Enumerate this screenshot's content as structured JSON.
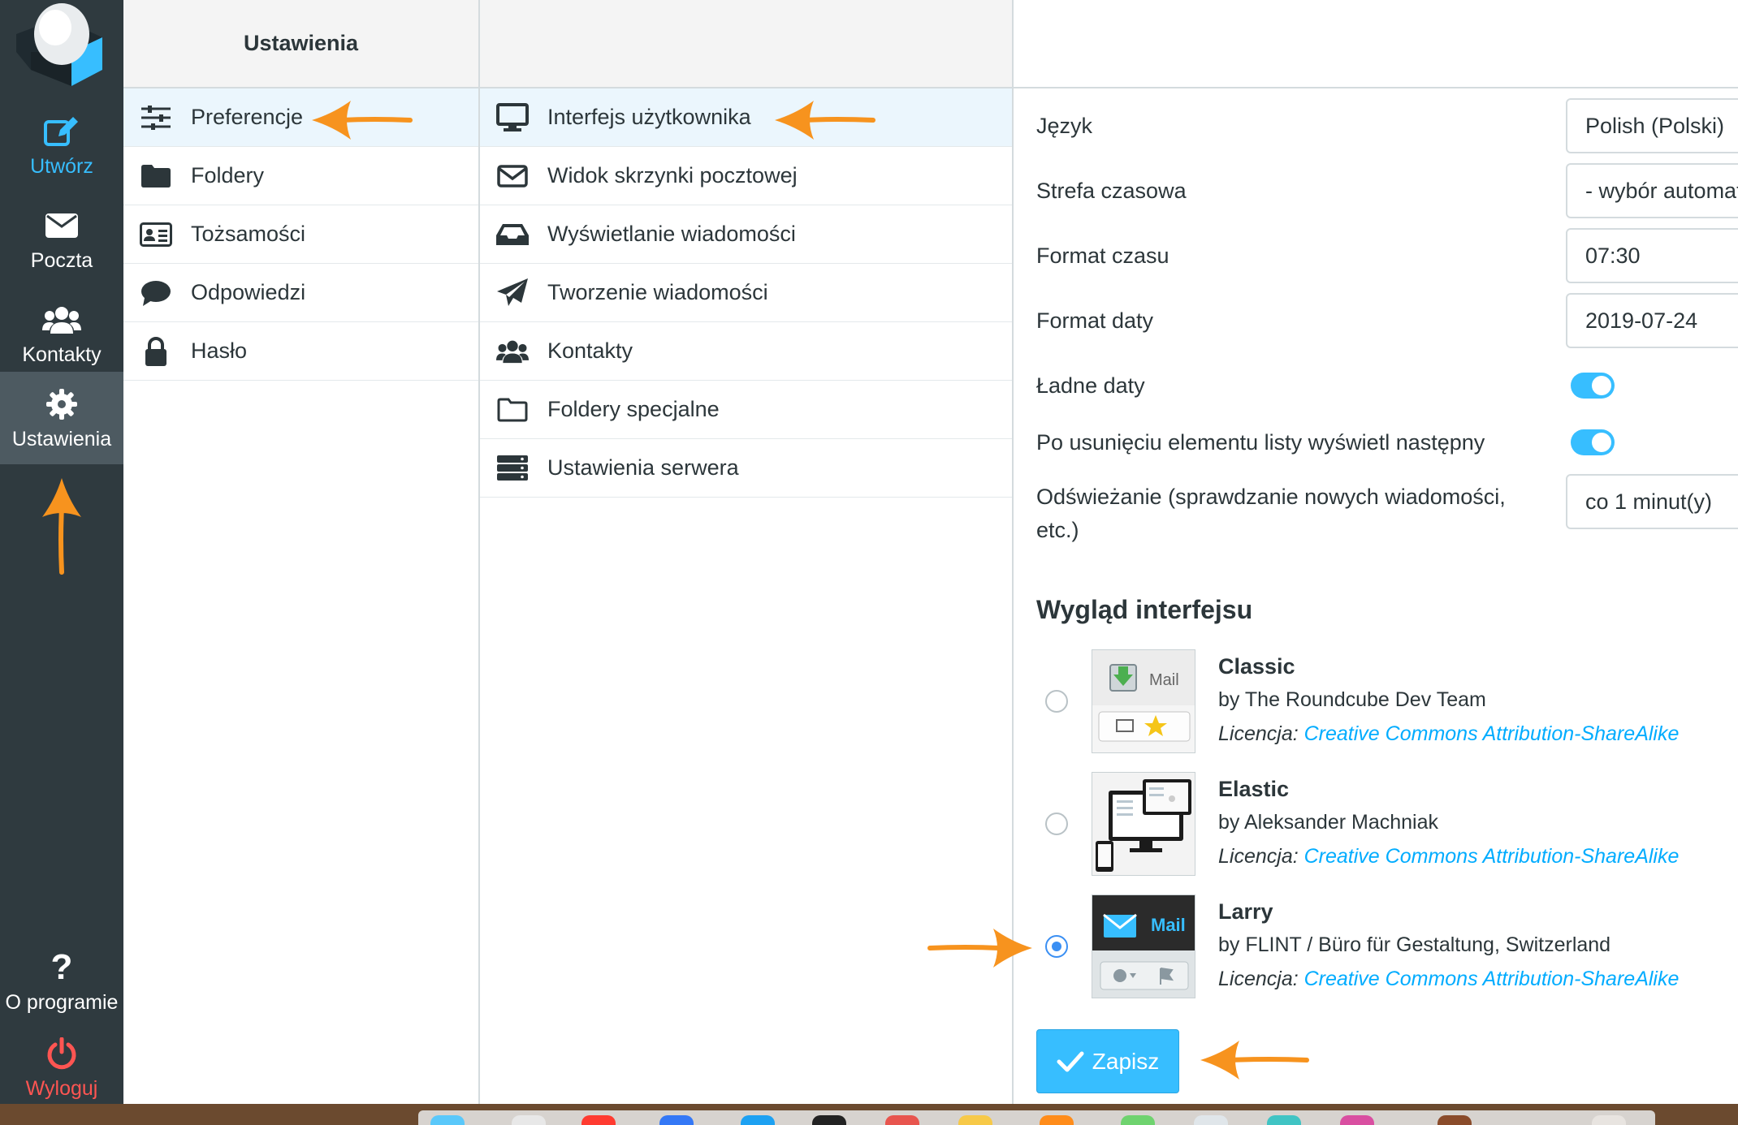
{
  "nav": {
    "compose_label": "Utwórz",
    "mail_label": "Poczta",
    "contacts_label": "Kontakty",
    "settings_label": "Ustawienia",
    "about_label": "O programie",
    "logout_label": "Wyloguj"
  },
  "settings_col": {
    "header": "Ustawienia",
    "items": [
      {
        "label": "Preferencje",
        "icon": "sliders-icon"
      },
      {
        "label": "Foldery",
        "icon": "folder-icon"
      },
      {
        "label": "Tożsamości",
        "icon": "id-card-icon"
      },
      {
        "label": "Odpowiedzi",
        "icon": "speech-bubble-icon"
      },
      {
        "label": "Hasło",
        "icon": "lock-icon"
      }
    ]
  },
  "sections_col": {
    "header": "",
    "items": [
      {
        "label": "Interfejs użytkownika",
        "icon": "monitor-icon"
      },
      {
        "label": "Widok skrzynki pocztowej",
        "icon": "envelope-icon"
      },
      {
        "label": "Wyświetlanie wiadomości",
        "icon": "inbox-icon"
      },
      {
        "label": "Tworzenie wiadomości",
        "icon": "paper-plane-icon"
      },
      {
        "label": "Kontakty",
        "icon": "users-icon"
      },
      {
        "label": "Foldery specjalne",
        "icon": "folder-outline-icon"
      },
      {
        "label": "Ustawienia serwera",
        "icon": "server-icon"
      }
    ]
  },
  "prefs": {
    "language_label": "Język",
    "language_value": "Polish (Polski)",
    "timezone_label": "Strefa czasowa",
    "timezone_value": "- wybór automatyczny -",
    "time_format_label": "Format czasu",
    "time_format_value": "07:30",
    "date_format_label": "Format daty",
    "date_format_value": "2019-07-24",
    "pretty_dates_label": "Ładne daty",
    "pretty_dates_on": true,
    "display_next_label": "Po usunięciu elementu listy wyświetl następny",
    "display_next_on": true,
    "refresh_label": "Odświeżanie (sprawdzanie nowych wiadomości, etc.)",
    "refresh_value": "co 1 minut(y)",
    "skin_section_title": "Wygląd interfejsu",
    "license_prefix": "Licencja:",
    "skins": [
      {
        "name": "Classic",
        "author": "by The Roundcube Dev Team",
        "license": "Creative Commons Attribution-ShareAlike",
        "selected": false
      },
      {
        "name": "Elastic",
        "author": "by Aleksander Machniak",
        "license": "Creative Commons Attribution-ShareAlike",
        "selected": false
      },
      {
        "name": "Larry",
        "author": "by FLINT / Büro für Gestaltung, Switzerland",
        "license": "Creative Commons Attribution-ShareAlike",
        "selected": true
      }
    ],
    "thumb_text": "Mail",
    "save_label": "Zapisz"
  },
  "colors": {
    "accent": "#37beff",
    "nav_bg": "#2f3a3f",
    "nav_active": "#4d5a61",
    "logout": "#ff5552",
    "annotation_arrow": "#f7931e"
  }
}
